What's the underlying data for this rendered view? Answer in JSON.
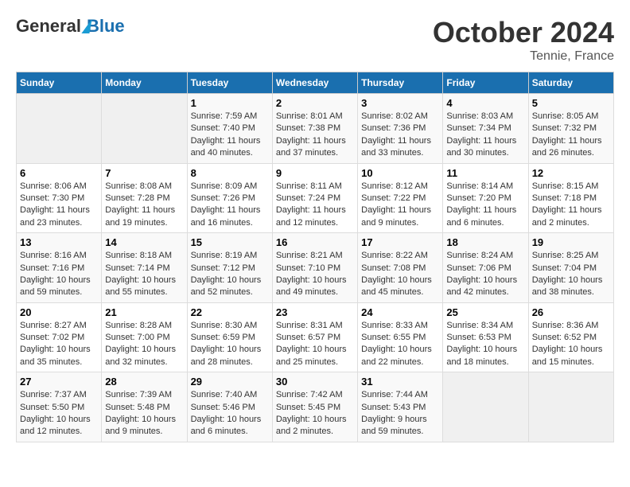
{
  "header": {
    "logo": {
      "general": "General",
      "blue": "Blue"
    },
    "title": "October 2024",
    "location": "Tennie, France"
  },
  "calendar": {
    "days_of_week": [
      "Sunday",
      "Monday",
      "Tuesday",
      "Wednesday",
      "Thursday",
      "Friday",
      "Saturday"
    ],
    "weeks": [
      [
        {
          "day": null,
          "info": null
        },
        {
          "day": null,
          "info": null
        },
        {
          "day": "1",
          "info": "Sunrise: 7:59 AM\nSunset: 7:40 PM\nDaylight: 11 hours and 40 minutes."
        },
        {
          "day": "2",
          "info": "Sunrise: 8:01 AM\nSunset: 7:38 PM\nDaylight: 11 hours and 37 minutes."
        },
        {
          "day": "3",
          "info": "Sunrise: 8:02 AM\nSunset: 7:36 PM\nDaylight: 11 hours and 33 minutes."
        },
        {
          "day": "4",
          "info": "Sunrise: 8:03 AM\nSunset: 7:34 PM\nDaylight: 11 hours and 30 minutes."
        },
        {
          "day": "5",
          "info": "Sunrise: 8:05 AM\nSunset: 7:32 PM\nDaylight: 11 hours and 26 minutes."
        }
      ],
      [
        {
          "day": "6",
          "info": "Sunrise: 8:06 AM\nSunset: 7:30 PM\nDaylight: 11 hours and 23 minutes."
        },
        {
          "day": "7",
          "info": "Sunrise: 8:08 AM\nSunset: 7:28 PM\nDaylight: 11 hours and 19 minutes."
        },
        {
          "day": "8",
          "info": "Sunrise: 8:09 AM\nSunset: 7:26 PM\nDaylight: 11 hours and 16 minutes."
        },
        {
          "day": "9",
          "info": "Sunrise: 8:11 AM\nSunset: 7:24 PM\nDaylight: 11 hours and 12 minutes."
        },
        {
          "day": "10",
          "info": "Sunrise: 8:12 AM\nSunset: 7:22 PM\nDaylight: 11 hours and 9 minutes."
        },
        {
          "day": "11",
          "info": "Sunrise: 8:14 AM\nSunset: 7:20 PM\nDaylight: 11 hours and 6 minutes."
        },
        {
          "day": "12",
          "info": "Sunrise: 8:15 AM\nSunset: 7:18 PM\nDaylight: 11 hours and 2 minutes."
        }
      ],
      [
        {
          "day": "13",
          "info": "Sunrise: 8:16 AM\nSunset: 7:16 PM\nDaylight: 10 hours and 59 minutes."
        },
        {
          "day": "14",
          "info": "Sunrise: 8:18 AM\nSunset: 7:14 PM\nDaylight: 10 hours and 55 minutes."
        },
        {
          "day": "15",
          "info": "Sunrise: 8:19 AM\nSunset: 7:12 PM\nDaylight: 10 hours and 52 minutes."
        },
        {
          "day": "16",
          "info": "Sunrise: 8:21 AM\nSunset: 7:10 PM\nDaylight: 10 hours and 49 minutes."
        },
        {
          "day": "17",
          "info": "Sunrise: 8:22 AM\nSunset: 7:08 PM\nDaylight: 10 hours and 45 minutes."
        },
        {
          "day": "18",
          "info": "Sunrise: 8:24 AM\nSunset: 7:06 PM\nDaylight: 10 hours and 42 minutes."
        },
        {
          "day": "19",
          "info": "Sunrise: 8:25 AM\nSunset: 7:04 PM\nDaylight: 10 hours and 38 minutes."
        }
      ],
      [
        {
          "day": "20",
          "info": "Sunrise: 8:27 AM\nSunset: 7:02 PM\nDaylight: 10 hours and 35 minutes."
        },
        {
          "day": "21",
          "info": "Sunrise: 8:28 AM\nSunset: 7:00 PM\nDaylight: 10 hours and 32 minutes."
        },
        {
          "day": "22",
          "info": "Sunrise: 8:30 AM\nSunset: 6:59 PM\nDaylight: 10 hours and 28 minutes."
        },
        {
          "day": "23",
          "info": "Sunrise: 8:31 AM\nSunset: 6:57 PM\nDaylight: 10 hours and 25 minutes."
        },
        {
          "day": "24",
          "info": "Sunrise: 8:33 AM\nSunset: 6:55 PM\nDaylight: 10 hours and 22 minutes."
        },
        {
          "day": "25",
          "info": "Sunrise: 8:34 AM\nSunset: 6:53 PM\nDaylight: 10 hours and 18 minutes."
        },
        {
          "day": "26",
          "info": "Sunrise: 8:36 AM\nSunset: 6:52 PM\nDaylight: 10 hours and 15 minutes."
        }
      ],
      [
        {
          "day": "27",
          "info": "Sunrise: 7:37 AM\nSunset: 5:50 PM\nDaylight: 10 hours and 12 minutes."
        },
        {
          "day": "28",
          "info": "Sunrise: 7:39 AM\nSunset: 5:48 PM\nDaylight: 10 hours and 9 minutes."
        },
        {
          "day": "29",
          "info": "Sunrise: 7:40 AM\nSunset: 5:46 PM\nDaylight: 10 hours and 6 minutes."
        },
        {
          "day": "30",
          "info": "Sunrise: 7:42 AM\nSunset: 5:45 PM\nDaylight: 10 hours and 2 minutes."
        },
        {
          "day": "31",
          "info": "Sunrise: 7:44 AM\nSunset: 5:43 PM\nDaylight: 9 hours and 59 minutes."
        },
        {
          "day": null,
          "info": null
        },
        {
          "day": null,
          "info": null
        }
      ]
    ]
  }
}
